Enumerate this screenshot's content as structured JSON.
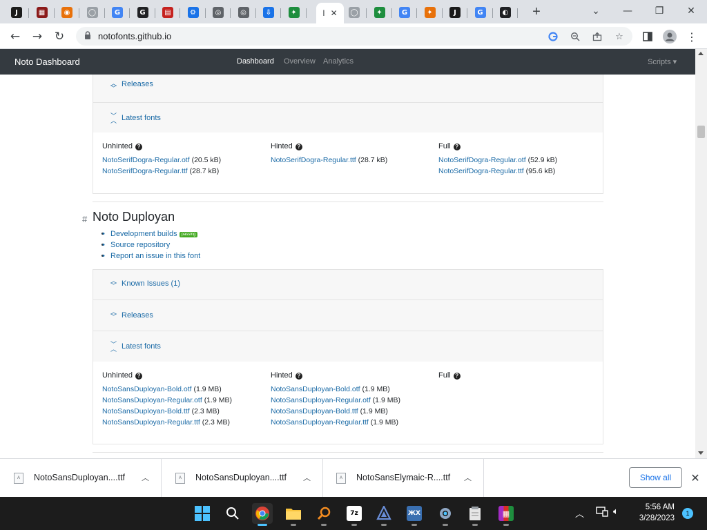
{
  "browser": {
    "tabs": [
      {
        "icon": "J",
        "color": "#1b1b1b"
      },
      {
        "icon": "▦",
        "color": "#8b1a1a"
      },
      {
        "icon": "◉",
        "color": "#e8710a"
      },
      {
        "icon": "◯",
        "color": "#9aa0a6"
      },
      {
        "icon": "G",
        "color": "#4285f4"
      },
      {
        "icon": "G",
        "color": "#202124"
      },
      {
        "icon": "▤",
        "color": "#c5221f"
      },
      {
        "icon": "⚙",
        "color": "#1a73e8"
      },
      {
        "icon": "◎",
        "color": "#5f6368"
      },
      {
        "icon": "◎",
        "color": "#5f6368"
      },
      {
        "icon": "⇩",
        "color": "#1a73e8"
      },
      {
        "icon": "✦",
        "color": "#1e8e3e"
      }
    ],
    "active_tab_label": "I",
    "tabs_after": [
      {
        "icon": "◯",
        "color": "#9aa0a6"
      },
      {
        "icon": "✦",
        "color": "#1e8e3e"
      },
      {
        "icon": "G",
        "color": "#4285f4"
      },
      {
        "icon": "✦",
        "color": "#e8710a"
      },
      {
        "icon": "J",
        "color": "#1b1b1b"
      },
      {
        "icon": "G",
        "color": "#4285f4"
      },
      {
        "icon": "◐",
        "color": "#202124"
      }
    ],
    "new_tab": "+",
    "url": "notofonts.github.io"
  },
  "navbar": {
    "brand": "Noto Dashboard",
    "links": [
      "Dashboard",
      "Overview",
      "Analytics"
    ],
    "scripts": "Scripts ▾"
  },
  "top_section": {
    "releases": "Releases",
    "latest_fonts": "Latest fonts",
    "unhinted_title": "Unhinted",
    "hinted_title": "Hinted",
    "full_title": "Full",
    "unhinted": [
      {
        "name": "NotoSerifDogra-Regular.otf",
        "size": "(20.5 kB)"
      },
      {
        "name": "NotoSerifDogra-Regular.ttf",
        "size": "(28.7 kB)"
      }
    ],
    "hinted": [
      {
        "name": "NotoSerifDogra-Regular.ttf",
        "size": "(28.7 kB)"
      }
    ],
    "full": [
      {
        "name": "NotoSerifDogra-Regular.otf",
        "size": "(52.9 kB)"
      },
      {
        "name": "NotoSerifDogra-Regular.ttf",
        "size": "(95.6 kB)"
      }
    ]
  },
  "duployan": {
    "hash": "#",
    "title": "Noto Duployan",
    "links": {
      "dev_builds": "Development builds",
      "badge": "passing",
      "source": "Source repository",
      "issue": "Report an issue in this font"
    },
    "known_issues": "Known Issues (1)",
    "releases": "Releases",
    "latest_fonts": "Latest fonts",
    "unhinted_title": "Unhinted",
    "hinted_title": "Hinted",
    "full_title": "Full",
    "unhinted": [
      {
        "name": "NotoSansDuployan-Bold.otf",
        "size": "(1.9 MB)"
      },
      {
        "name": "NotoSansDuployan-Regular.otf",
        "size": "(1.9 MB)"
      },
      {
        "name": "NotoSansDuployan-Bold.ttf",
        "size": "(2.3 MB)"
      },
      {
        "name": "NotoSansDuployan-Regular.ttf",
        "size": "(2.3 MB)"
      }
    ],
    "hinted": [
      {
        "name": "NotoSansDuployan-Bold.otf",
        "size": "(1.9 MB)"
      },
      {
        "name": "NotoSansDuployan-Regular.otf",
        "size": "(1.9 MB)"
      },
      {
        "name": "NotoSansDuployan-Bold.ttf",
        "size": "(1.9 MB)"
      },
      {
        "name": "NotoSansDuployan-Regular.ttf",
        "size": "(1.9 MB)"
      }
    ]
  },
  "downloads": {
    "items": [
      "NotoSansDuployan....ttf",
      "NotoSansDuployan....ttf",
      "NotoSansElymaic-R....ttf"
    ],
    "show_all": "Show all"
  },
  "taskbar": {
    "time": "5:56 AM",
    "date": "3/28/2023",
    "notifications": "1"
  }
}
